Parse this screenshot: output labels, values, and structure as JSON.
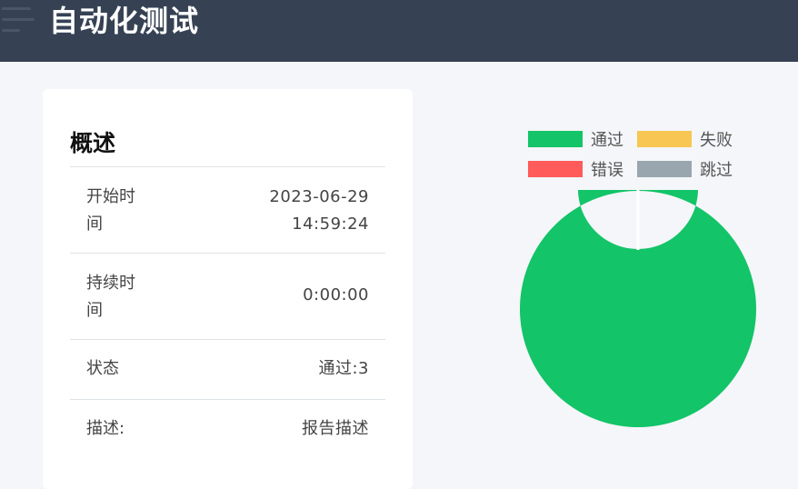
{
  "header": {
    "title": "自动化测试"
  },
  "summary": {
    "title": "概述",
    "rows": [
      {
        "label": "开始时间",
        "value": "2023-06-29 14:59:24"
      },
      {
        "label": "持续时间",
        "value": "0:00:00"
      },
      {
        "label": "状态",
        "value": "通过:3"
      },
      {
        "label": "描述:",
        "value": "报告描述"
      }
    ]
  },
  "legend": [
    {
      "label": "通过",
      "color": "#13c468"
    },
    {
      "label": "失败",
      "color": "#f7c653"
    },
    {
      "label": "错误",
      "color": "#ff5b5b"
    },
    {
      "label": "跳过",
      "color": "#9aa6ad"
    }
  ],
  "chart_data": {
    "type": "pie",
    "labels": [
      "通过",
      "失败",
      "错误",
      "跳过"
    ],
    "values": [
      3,
      0,
      0,
      0
    ],
    "colors": [
      "#13c468",
      "#f7c653",
      "#ff5b5b",
      "#9aa6ad"
    ]
  }
}
